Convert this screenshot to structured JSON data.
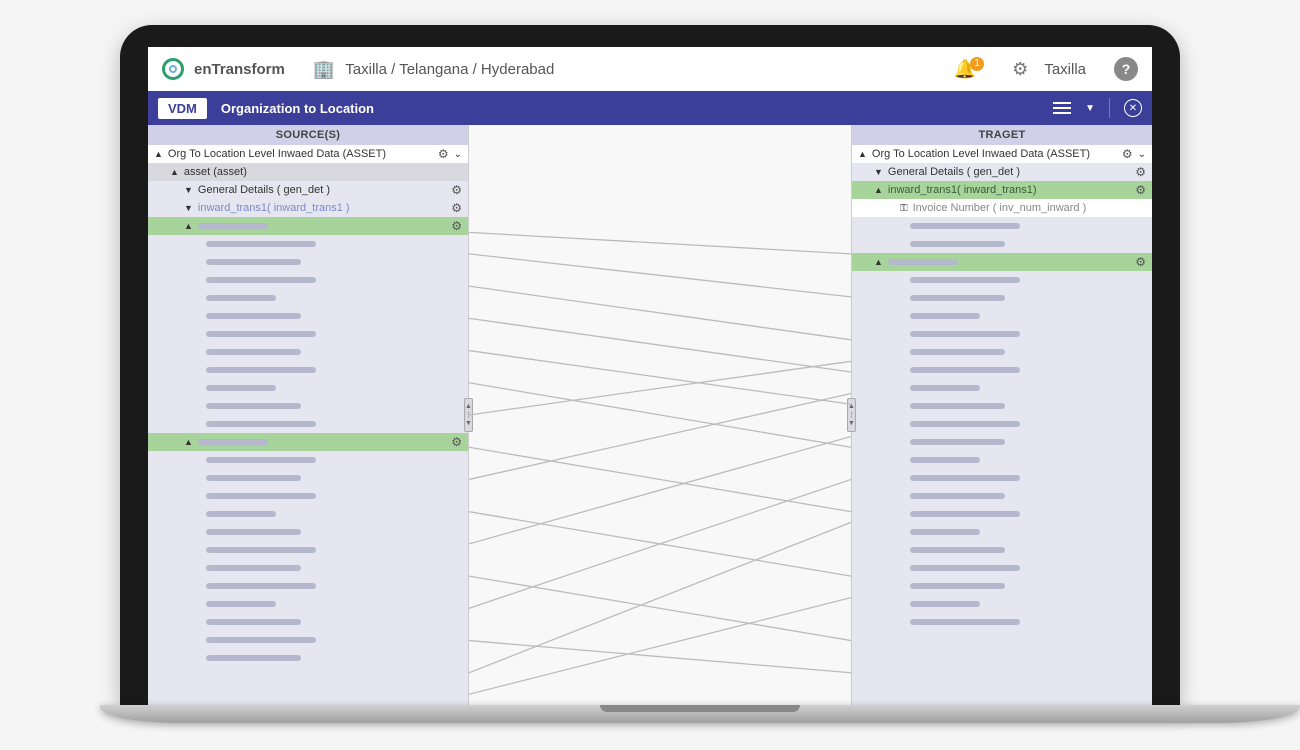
{
  "header": {
    "brand": "enTransform",
    "breadcrumb": "Taxilla / Telangana  / Hyderabad",
    "notification_count": "1",
    "user": "Taxilla",
    "help": "?"
  },
  "nav": {
    "vdm": "VDM",
    "title": "Organization to Location"
  },
  "source": {
    "header": "SOURCE(S)",
    "root": "Org To Location Level Inwaed Data (ASSET)",
    "asset": "asset (asset)",
    "gendet": "General Details ( gen_det )",
    "inward": "inward_trans1( inward_trans1 )"
  },
  "target": {
    "header": "TRAGET",
    "root": "Org To Location Level Inwaed Data (ASSET)",
    "gendet": "General Details ( gen_det )",
    "inward": "inward_trans1( inward_trans1)",
    "keyfield": "Invoice Number ( inv_num_inward )"
  }
}
